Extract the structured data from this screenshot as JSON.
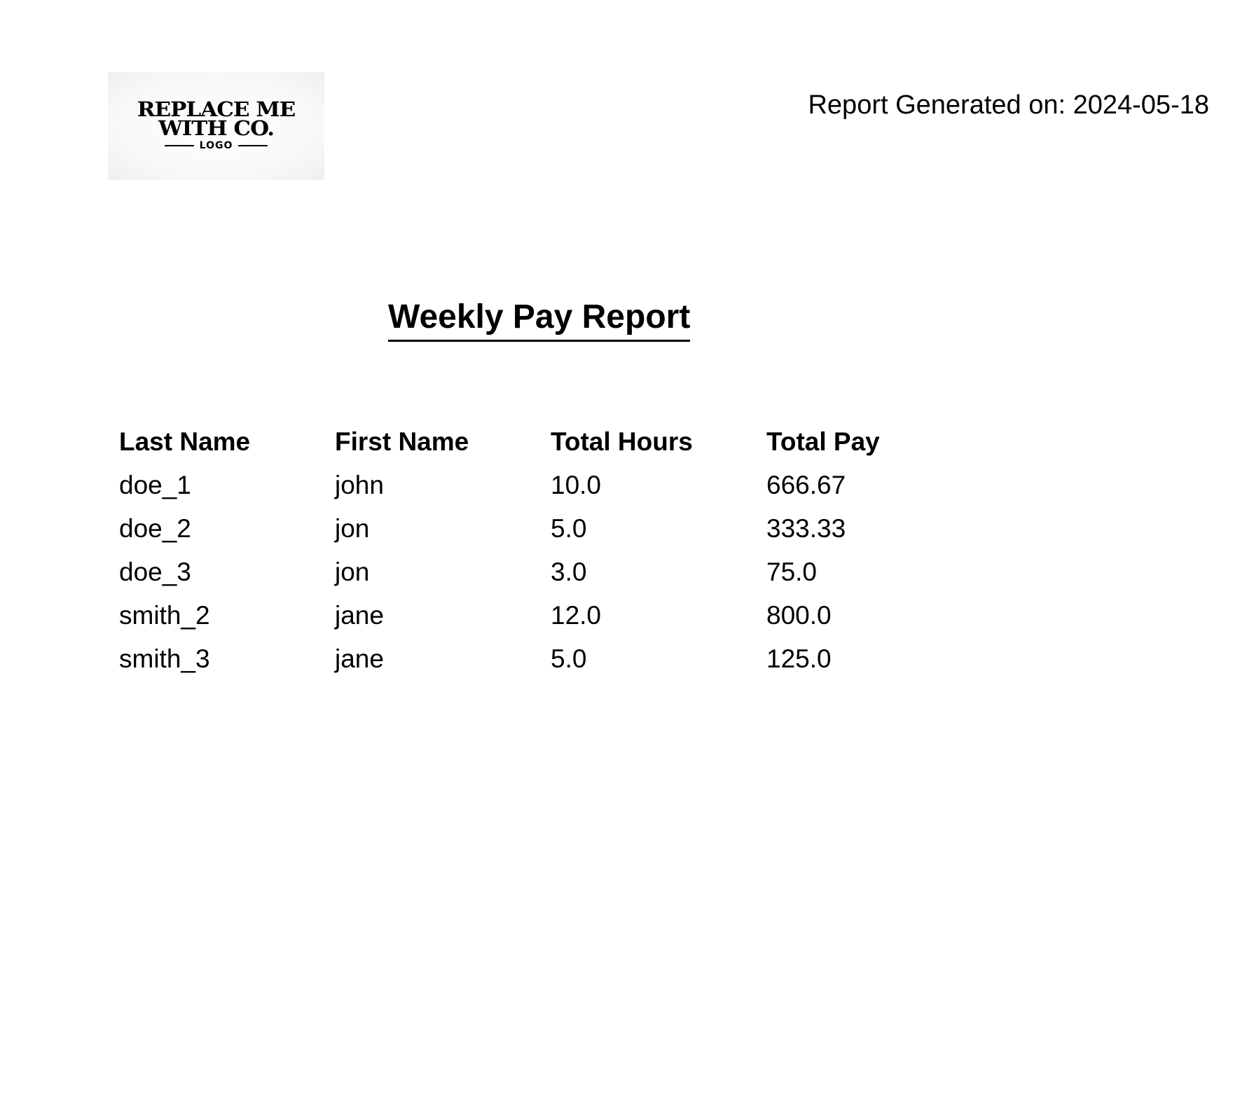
{
  "logo": {
    "line1": "REPLACE ME",
    "line2": "WITH CO.",
    "sub": "LOGO"
  },
  "header": {
    "report_date": "Report Generated on: 2024-05-18"
  },
  "report": {
    "title": "Weekly Pay Report"
  },
  "table": {
    "headers": [
      "Last Name",
      "First Name",
      "Total Hours",
      "Total Pay"
    ],
    "rows": [
      [
        "doe_1",
        "john",
        "10.0",
        "666.67"
      ],
      [
        "doe_2",
        "jon",
        "5.0",
        "333.33"
      ],
      [
        "doe_3",
        "jon",
        "3.0",
        "75.0"
      ],
      [
        "smith_2",
        "jane",
        "12.0",
        "800.0"
      ],
      [
        "smith_3",
        "jane",
        "5.0",
        "125.0"
      ]
    ]
  }
}
